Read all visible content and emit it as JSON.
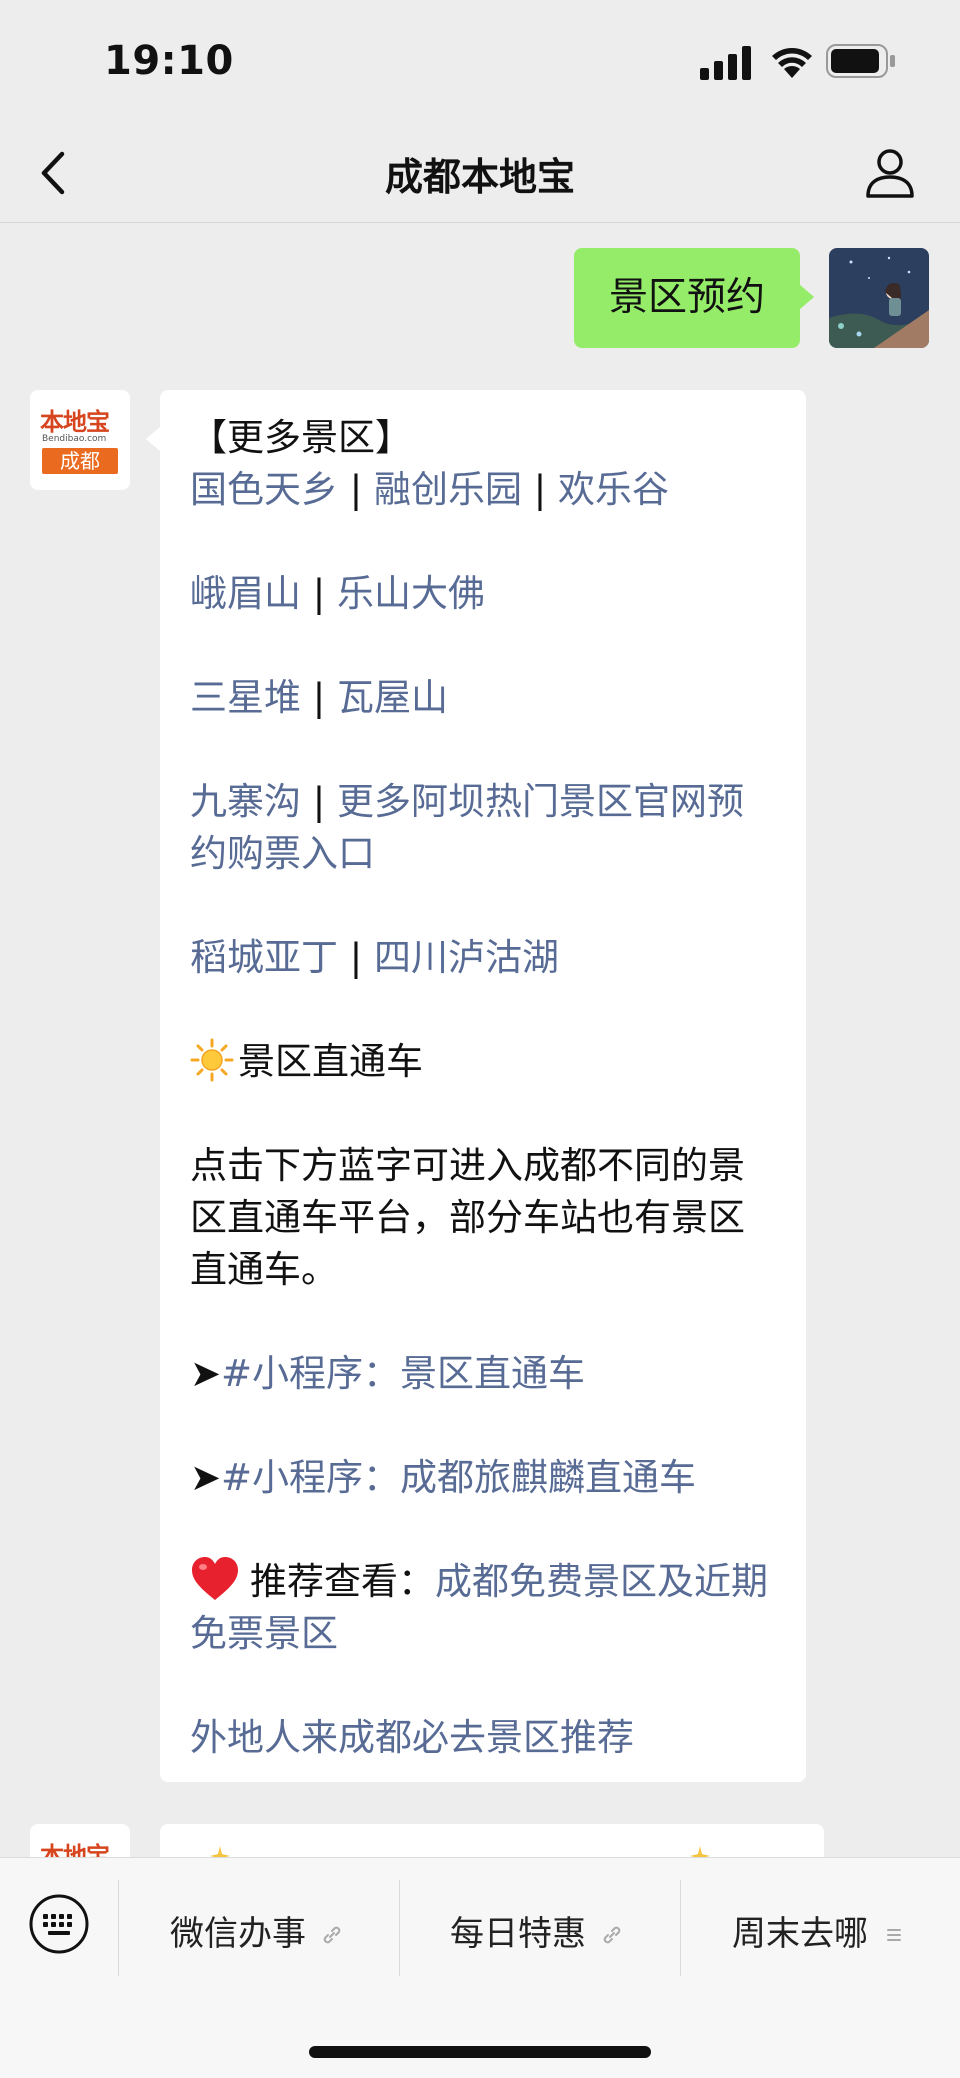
{
  "status_bar": {
    "time": "19:10"
  },
  "nav": {
    "title": "成都本地宝"
  },
  "sent": {
    "text": "景区预约"
  },
  "bot": {
    "avatar_top": "本地宝",
    "avatar_mid": "Bendibao.com",
    "avatar_bottom": "成都"
  },
  "message": {
    "header": "【更多景区】",
    "sep": " | ",
    "line1": [
      "国色天乡",
      "融创乐园",
      "欢乐谷"
    ],
    "line2": [
      "峨眉山",
      "乐山大佛"
    ],
    "line3": [
      "三星堆",
      "瓦屋山"
    ],
    "line4": [
      "九寨沟",
      "更多阿坝热门景区官网预约购票入口"
    ],
    "line5": [
      "稻城亚丁",
      "四川泸沽湖"
    ],
    "section_title": "景区直通车",
    "paragraph": "点击下方蓝字可进入成都不同的景区直通车平台，部分车站也有景区直通车。",
    "arrow": "➤",
    "mini1": "#小程序：景区直通车",
    "mini2": "#小程序：成都旅麒麟直通车",
    "recommend_label": "推荐查看：",
    "recommend_link": "成都免费景区及近期免票景区",
    "last_link": "外地人来成都必去景区推荐"
  },
  "menu": {
    "items": [
      "微信办事",
      "每日特惠",
      "周末去哪"
    ]
  },
  "colors": {
    "background": "#ededed",
    "sent_bubble": "#95ec69",
    "link": "#576b95",
    "brand_orange": "#ea6a1f"
  }
}
